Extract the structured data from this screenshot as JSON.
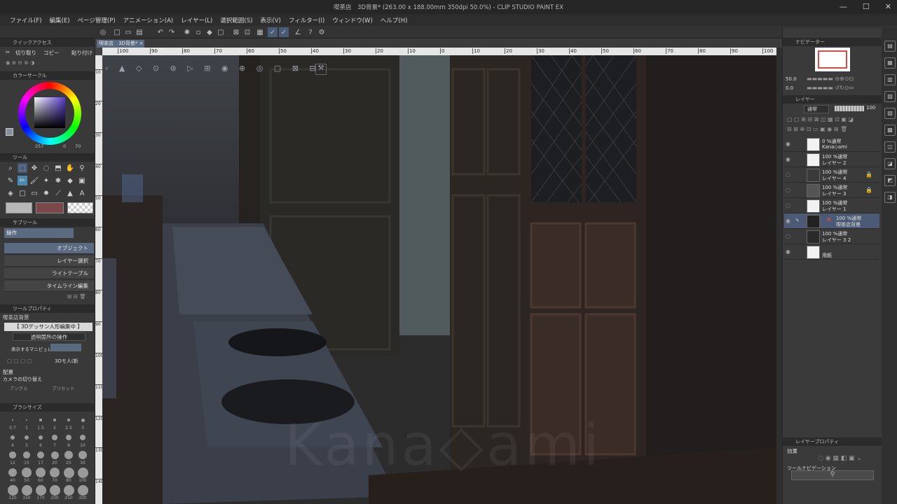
{
  "titlebar": {
    "title": "喫茶店　3D背景* (263.00 x 188.00mm 350dpi 50.0%)  - CLIP STUDIO PAINT EX"
  },
  "menu": [
    "ファイル(F)",
    "編集(E)",
    "ページ管理(P)",
    "アニメーション(A)",
    "レイヤー(L)",
    "選択範囲(S)",
    "表示(V)",
    "フィルター(I)",
    "ウィンドウ(W)",
    "ヘルプ(H)"
  ],
  "document_tab": "喫茶店　3D背景* ×",
  "left": {
    "quick_access": {
      "header": "クイックアクセス",
      "items": [
        "切り取り",
        "コピー",
        "貼り付け"
      ]
    },
    "color_circle": {
      "header": "カラーサークル",
      "h": "257",
      "s": "0",
      "v": "70"
    },
    "tool_header": "ツール",
    "subtool": {
      "header": "サブツール",
      "group": "操作",
      "items": [
        "オブジェクト",
        "レイヤー選択",
        "ライトテーブル",
        "タイムライン編集"
      ]
    },
    "tool_property": {
      "header": "ツールプロパティ",
      "object": "喫茶店背景",
      "banner": "【 3Dデッサン人形編集中 】",
      "transparent": "透明箇所の操作",
      "manipulator_label": "表示するマニピュレータ",
      "mode_label": "3Dモ人(新",
      "placement": "配置",
      "camera": "カメラの切り替え",
      "angle": "アングル",
      "preset": "プリセット"
    },
    "brush_size": {
      "header": "ブラシサイズ",
      "values": [
        "0.7",
        "1",
        "1.5",
        "2",
        "2.5",
        "3",
        "4",
        "5",
        "6",
        "7",
        "8",
        "10",
        "12",
        "15",
        "17",
        "20",
        "25",
        "30",
        "40",
        "50",
        "60",
        "70",
        "80",
        "100",
        "120",
        "150",
        "170",
        "200",
        "250",
        "300"
      ]
    }
  },
  "ruler_h": [
    "100",
    "90",
    "80",
    "70",
    "60",
    "50",
    "40",
    "30",
    "20",
    "10",
    "0",
    "10",
    "20",
    "30",
    "40",
    "50",
    "60",
    "70",
    "80",
    "90",
    "100"
  ],
  "ruler_v": [
    "10",
    "20",
    "30",
    "40",
    "50",
    "60",
    "70",
    "80",
    "90",
    "100",
    "110",
    "120",
    "130",
    "140"
  ],
  "canvas": {
    "watermark": "Kana◇ami"
  },
  "right": {
    "navigator_header": "ナビゲーター",
    "zoom": "50.0",
    "rotation": "0.0",
    "layer_header": "レイヤー",
    "blend_mode": "通常",
    "opacity": "100",
    "layers": [
      {
        "pct": "0 %通常",
        "name": "Kana◇ami",
        "lock": ""
      },
      {
        "pct": "100 %通常",
        "name": "レイヤー 2",
        "lock": ""
      },
      {
        "pct": "100 %通常",
        "name": "レイヤー 4",
        "lock": "🔒"
      },
      {
        "pct": "100 %通常",
        "name": "レイヤー 3",
        "lock": "🔒"
      },
      {
        "pct": "100 %通常",
        "name": "レイヤー 1",
        "lock": ""
      },
      {
        "pct": "100 %通常",
        "name": "喫茶店背景",
        "lock": ""
      },
      {
        "pct": "100 %通常",
        "name": "レイヤー 3 2",
        "lock": ""
      },
      {
        "pct": "",
        "name": "用紙",
        "lock": ""
      }
    ],
    "layer_property_header": "レイヤープロパティ",
    "effect_label": "効果",
    "tool_nav_label": "ツールナビゲーション"
  },
  "colors": {
    "accent": "#5a6a80",
    "selected_layer": "#4c5a75",
    "panel": "#3a3a3a"
  }
}
